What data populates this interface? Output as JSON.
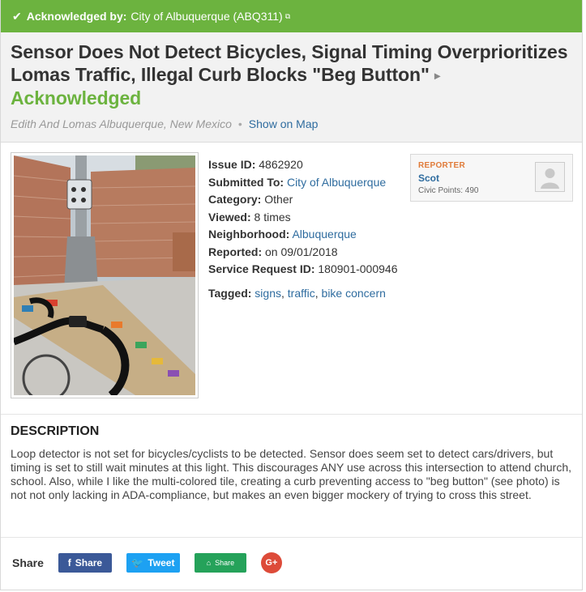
{
  "ack": {
    "prefix": "Acknowledged by:",
    "org": "City of Albuquerque (ABQ311)",
    "check_icon": "check-icon",
    "external_icon": "external-link-icon"
  },
  "issue": {
    "title": "Sensor Does Not Detect Bicycles, Signal Timing Overprioritizes Lomas Traffic, Illegal Curb Blocks \"Beg Button\"",
    "status": "Acknowledged",
    "location": "Edith And Lomas Albuquerque, New Mexico",
    "separator": "•",
    "map_link": "Show on Map"
  },
  "details": {
    "issue_id_label": "Issue ID:",
    "issue_id": "4862920",
    "submitted_label": "Submitted To:",
    "submitted_to": "City of Albuquerque",
    "category_label": "Category:",
    "category": "Other",
    "viewed_label": "Viewed:",
    "viewed": "8 times",
    "neighborhood_label": "Neighborhood:",
    "neighborhood": "Albuquerque",
    "reported_label": "Reported:",
    "reported": "on 09/01/2018",
    "service_label": "Service Request ID:",
    "service_id": "180901-000946",
    "tagged_label": "Tagged:",
    "tags": [
      "signs",
      "traffic",
      "bike concern"
    ],
    "tag_sep": ","
  },
  "reporter": {
    "label": "REPORTER",
    "name": "Scot",
    "points_label": "Civic Points:",
    "points": "490"
  },
  "description": {
    "heading": "DESCRIPTION",
    "text": "Loop detector is not set for bicycles/cyclists to be detected. Sensor does seem set to detect cars/drivers, but timing is set to still wait minutes at this light. This discourages ANY use across this intersection to attend church, school. Also, while I like the multi-colored tile, creating a curb preventing access to \"beg button\" (see photo) is not not only lacking in ADA-compliance, but makes an even bigger mockery of trying to cross this street."
  },
  "share": {
    "label": "Share",
    "facebook": "Share",
    "twitter": "Tweet",
    "nextdoor": "Share",
    "google": "G+"
  },
  "colors": {
    "ack_green": "#6cb33f",
    "link_blue": "#2f6c9f",
    "facebook": "#3b5998",
    "twitter": "#1da1f2",
    "nextdoor": "#25a25a",
    "google": "#dd4b39"
  }
}
